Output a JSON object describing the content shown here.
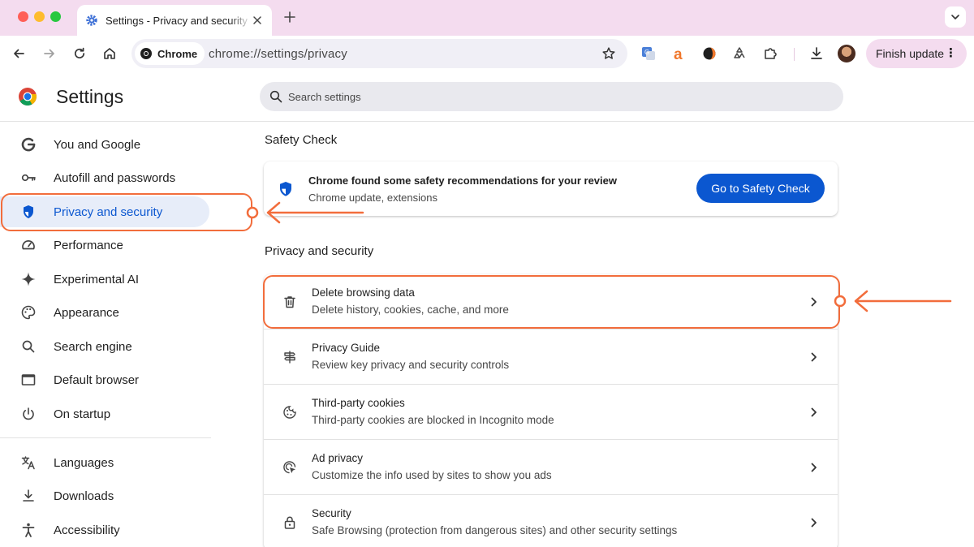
{
  "browser": {
    "tab": {
      "title": "Settings - Privacy and security",
      "icon": "gear-icon"
    },
    "toolbar": {
      "chip_label": "Chrome",
      "url": "chrome://settings/privacy",
      "finish_update_label": "Finish update",
      "extensions": [
        "translate-extension-icon",
        "a-extension-icon",
        "orange-extension-icon",
        "recycle-extension-icon",
        "puzzle-icon"
      ]
    }
  },
  "settings": {
    "title": "Settings",
    "search_placeholder": "Search settings"
  },
  "sidebar": {
    "items": [
      {
        "label": "You and Google",
        "icon": "google-g-icon",
        "active": false
      },
      {
        "label": "Autofill and passwords",
        "icon": "key-icon",
        "active": false
      },
      {
        "label": "Privacy and security",
        "icon": "shield-icon",
        "active": true
      },
      {
        "label": "Performance",
        "icon": "gauge-icon",
        "active": false
      },
      {
        "label": "Experimental AI",
        "icon": "sparkle-icon",
        "active": false
      },
      {
        "label": "Appearance",
        "icon": "palette-icon",
        "active": false
      },
      {
        "label": "Search engine",
        "icon": "search-icon",
        "active": false
      },
      {
        "label": "Default browser",
        "icon": "browser-window-icon",
        "active": false
      },
      {
        "label": "On startup",
        "icon": "power-icon",
        "active": false
      },
      {
        "label": "Languages",
        "icon": "translate-icon",
        "active": false
      },
      {
        "label": "Downloads",
        "icon": "download-icon",
        "active": false
      },
      {
        "label": "Accessibility",
        "icon": "accessibility-icon",
        "active": false
      }
    ]
  },
  "main": {
    "safety_check": {
      "heading": "Safety Check",
      "title": "Chrome found some safety recommendations for your review",
      "subtitle": "Chrome update, extensions",
      "button_label": "Go to Safety Check"
    },
    "privacy": {
      "heading": "Privacy and security",
      "rows": [
        {
          "title": "Delete browsing data",
          "subtitle": "Delete history, cookies, cache, and more",
          "icon": "trash-icon"
        },
        {
          "title": "Privacy Guide",
          "subtitle": "Review key privacy and security controls",
          "icon": "signpost-icon"
        },
        {
          "title": "Third-party cookies",
          "subtitle": "Third-party cookies are blocked in Incognito mode",
          "icon": "cookie-icon"
        },
        {
          "title": "Ad privacy",
          "subtitle": "Customize the info used by sites to show you ads",
          "icon": "ad-target-icon"
        },
        {
          "title": "Security",
          "subtitle": "Safe Browsing (protection from dangerous sites) and other security settings",
          "icon": "lock-icon"
        }
      ]
    }
  },
  "colors": {
    "accent": "#0b57d0",
    "annotation": "#f26d3c",
    "tabstrip": "#f4dcef"
  }
}
